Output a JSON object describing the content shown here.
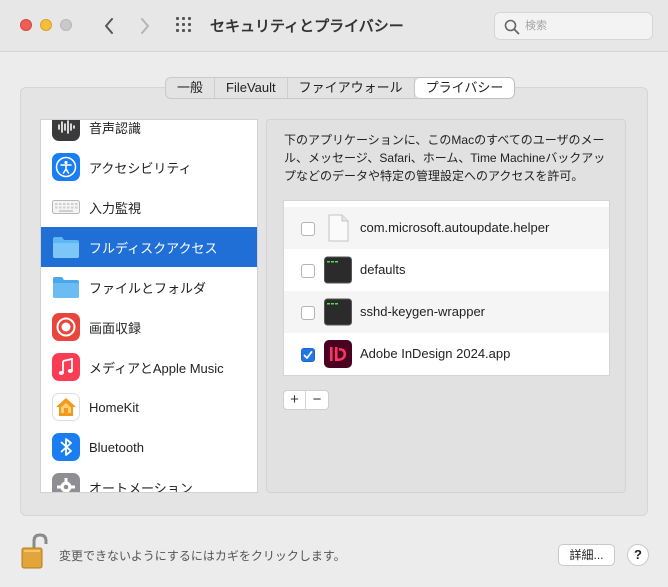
{
  "window": {
    "title": "セキュリティとプライバシー",
    "search_placeholder": "検索"
  },
  "tabs": [
    {
      "label": "一般",
      "active": false
    },
    {
      "label": "FileVault",
      "active": false
    },
    {
      "label": "ファイアウォール",
      "active": false
    },
    {
      "label": "プライバシー",
      "active": true
    }
  ],
  "sidebar": {
    "items": [
      {
        "label": "音声認識",
        "icon": "waveform-icon",
        "selected": false
      },
      {
        "label": "アクセシビリティ",
        "icon": "accessibility-icon",
        "selected": false
      },
      {
        "label": "入力監視",
        "icon": "keyboard-icon",
        "selected": false
      },
      {
        "label": "フルディスクアクセス",
        "icon": "folder-icon",
        "selected": true
      },
      {
        "label": "ファイルとフォルダ",
        "icon": "folder-icon",
        "selected": false
      },
      {
        "label": "画面収録",
        "icon": "screen-record-icon",
        "selected": false
      },
      {
        "label": "メディアとApple Music",
        "icon": "music-icon",
        "selected": false
      },
      {
        "label": "HomeKit",
        "icon": "home-icon",
        "selected": false
      },
      {
        "label": "Bluetooth",
        "icon": "bluetooth-icon",
        "selected": false
      },
      {
        "label": "オートメーション",
        "icon": "gear-icon",
        "selected": false
      }
    ]
  },
  "main": {
    "description": "下のアプリケーションに、このMacのすべてのユーザのメール、メッセージ、Safari、ホーム、Time Machineバックアップなどのデータや特定の管理設定へのアクセスを許可。",
    "apps": [
      {
        "name": "com.microsoft.autoupdate.helper",
        "checked": false,
        "icon": "document-icon"
      },
      {
        "name": "defaults",
        "checked": false,
        "icon": "terminal-icon"
      },
      {
        "name": "sshd-keygen-wrapper",
        "checked": false,
        "icon": "terminal-icon"
      },
      {
        "name": "Adobe InDesign 2024.app",
        "checked": true,
        "icon": "indesign-icon"
      }
    ],
    "add_label": "+",
    "remove_label": "−"
  },
  "footer": {
    "lock_text": "変更できないようにするにはカギをクリックします。",
    "advanced_label": "詳細...",
    "help_label": "?"
  },
  "colors": {
    "selection": "#1f6fd6",
    "checkbox_on": "#2276e3",
    "close": "#ec5f57",
    "minimize": "#f4be3b",
    "indesign": "#49021f"
  }
}
